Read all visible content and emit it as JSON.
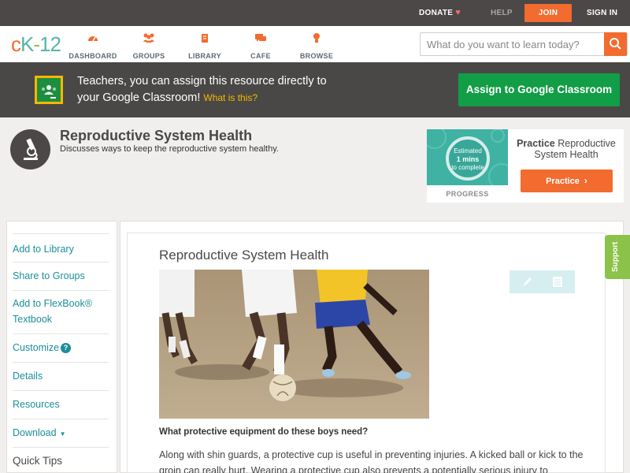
{
  "topbar": {
    "donate": "DONATE",
    "help": "HELP",
    "join": "JOIN",
    "signin": "SIGN IN"
  },
  "logo": {
    "c": "c",
    "k": "K",
    "dash": "-",
    "num": "12"
  },
  "nav": {
    "items": [
      {
        "label": "DASHBOARD",
        "icon": "dashboard-icon"
      },
      {
        "label": "GROUPS",
        "icon": "groups-icon"
      },
      {
        "label": "LIBRARY",
        "icon": "library-icon"
      },
      {
        "label": "CAFE",
        "icon": "cafe-icon"
      },
      {
        "label": "BROWSE",
        "icon": "browse-icon"
      }
    ]
  },
  "search": {
    "placeholder": "What do you want to learn today?"
  },
  "classroom": {
    "text_line1": "Teachers, you can assign this resource directly to",
    "text_line2": "your Google Classroom!",
    "link": "What is this?",
    "button": "Assign to Google Classroom"
  },
  "concept": {
    "title": "Reproductive System Health",
    "subtitle": "Discusses ways to keep the reproductive system healthy."
  },
  "progress_card": {
    "estimate_line1": "Estimated",
    "estimate_line2": "1 mins",
    "estimate_line3": "to complete",
    "progress_label": "PROGRESS",
    "practice_bold": "Practice",
    "practice_title": "Reproductive System Health",
    "practice_button": "Practice"
  },
  "sidebar": {
    "items": [
      {
        "label": "Add to Library"
      },
      {
        "label": "Share to Groups"
      },
      {
        "label": "Add to FlexBook® Textbook"
      },
      {
        "label": "Customize"
      },
      {
        "label": "Details"
      },
      {
        "label": "Resources"
      },
      {
        "label": "Download"
      }
    ],
    "customize_help": "?",
    "quick_tips": "Quick Tips"
  },
  "article": {
    "title": "Reproductive System Health",
    "caption": "What protective equipment do these boys need?",
    "body": "Along with shin guards, a protective cup is useful in preventing injuries. A kicked ball or kick to the groin can really hurt. Wearing a protective cup also prevents a potentially serious injury to"
  },
  "support": "Support",
  "colors": {
    "accent": "#f26b2f",
    "teal": "#1b8f9a",
    "green": "#129d47",
    "dark": "#4b4847"
  }
}
